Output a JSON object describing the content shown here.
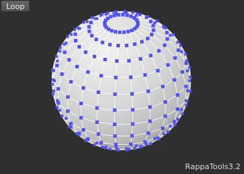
{
  "toolbar": {
    "loop_label": "Loop"
  },
  "viewport": {
    "watermark": "RappaTools3.2"
  },
  "sphere": {
    "object": "sphere-mesh",
    "selection_mode": "vertices",
    "colors": {
      "background": "#2f2f2f",
      "mesh_surface": "#d6d6d6",
      "mesh_shadow": "#8f8f8f",
      "edges": "#ffffff",
      "selected_vertices": "#5252f0"
    }
  }
}
